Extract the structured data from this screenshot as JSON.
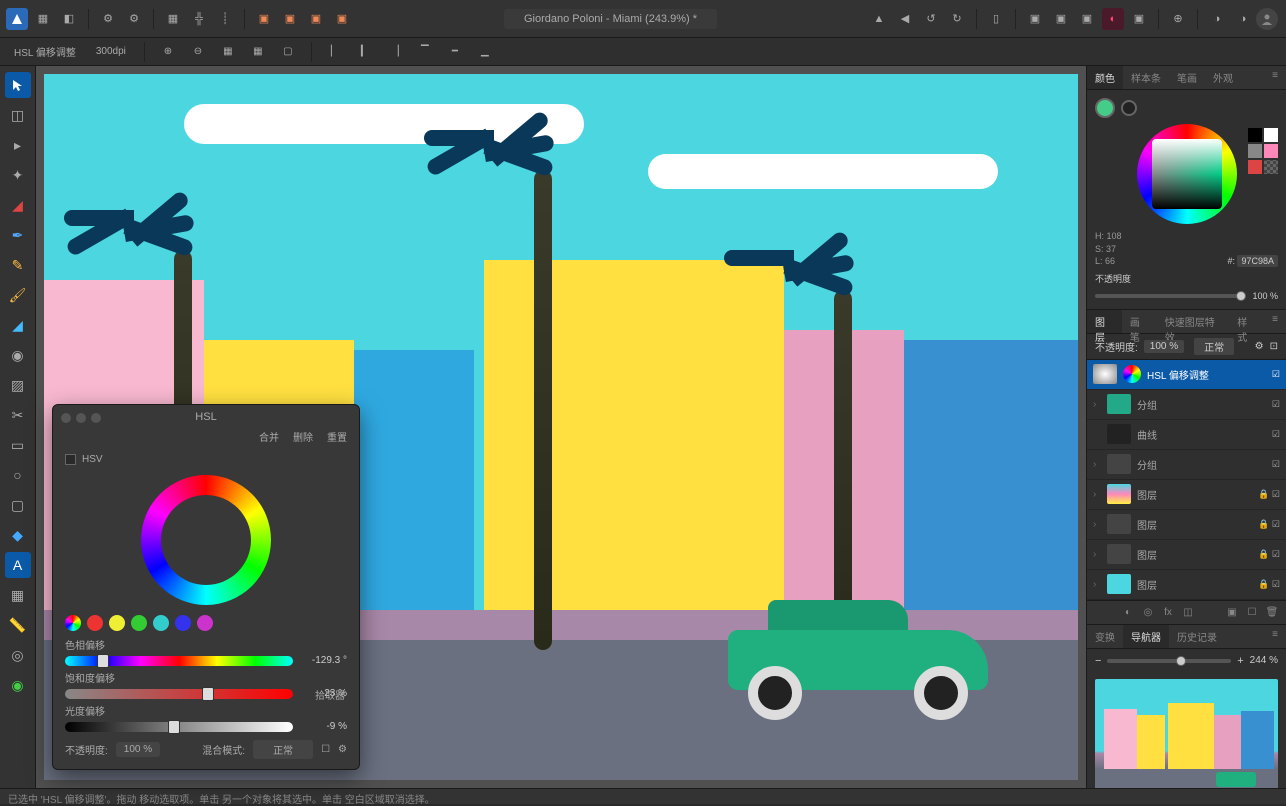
{
  "document": {
    "title": "Giordano Poloni - Miami (243.9%)",
    "modified": "*"
  },
  "context_bar": {
    "label": "HSL 偏移调整",
    "dpi": "300dpi"
  },
  "color_panel": {
    "tabs": [
      "颜色",
      "样本条",
      "笔画",
      "外观"
    ],
    "hsl": {
      "h": "H: 108",
      "s": "S: 37",
      "l": "L: 66"
    },
    "hex_label": "#:",
    "hex": "97C98A",
    "opacity_label": "不透明度",
    "opacity_value": "100 %"
  },
  "layers_panel": {
    "tabs": [
      "图层",
      "画笔",
      "快速图层特效",
      "样式"
    ],
    "opacity_label": "不透明度:",
    "opacity_value": "100 %",
    "blend_mode": "正常",
    "items": [
      {
        "name": "HSL 偏移调整",
        "selected": true
      },
      {
        "name": "分组"
      },
      {
        "name": "曲线"
      },
      {
        "name": "分组"
      },
      {
        "name": "图层"
      },
      {
        "name": "图层"
      },
      {
        "name": "图层"
      },
      {
        "name": "图层"
      }
    ]
  },
  "nav_panel": {
    "tabs": [
      "变换",
      "导航器",
      "历史记录"
    ],
    "zoom": "244 %"
  },
  "hsl_dialog": {
    "title": "HSL",
    "merge": "合并",
    "delete": "删除",
    "reset": "重置",
    "hsv_label": "HSV",
    "picker_label": "拾取器",
    "hue_label": "色相偏移",
    "hue_value": "-129.3 °",
    "sat_label": "饱和度偏移",
    "sat_value": "23 %",
    "lum_label": "光度偏移",
    "lum_value": "-9 %",
    "opacity_label": "不透明度:",
    "opacity_value": "100 %",
    "blend_label": "混合模式:",
    "blend_value": "正常"
  },
  "status": "已选中 'HSL 偏移调整'。拖动 移动选取项。单击 另一个对象将其选中。单击 空白区域取消选择。",
  "colors": {
    "accent": "#0a5aa8",
    "sky": "#4bd6e0"
  }
}
